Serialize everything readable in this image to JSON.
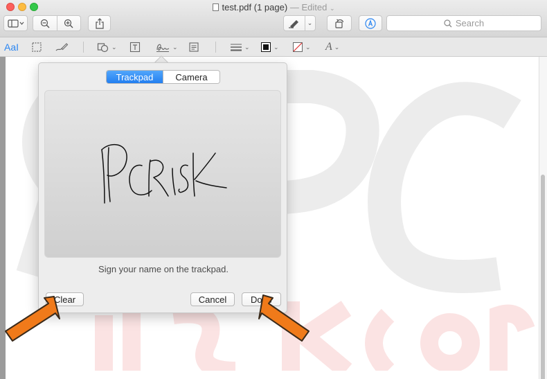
{
  "window": {
    "filename": "test.pdf (1 page)",
    "separator": "—",
    "edited_label": "Edited"
  },
  "toolbar": {
    "search_placeholder": "Search"
  },
  "popover": {
    "tabs": [
      {
        "label": "Trackpad",
        "active": true
      },
      {
        "label": "Camera",
        "active": false
      }
    ],
    "signature_text": "PCRISK",
    "hint": "Sign your name on the trackpad.",
    "clear_label": "Clear",
    "cancel_label": "Cancel",
    "done_label": "Done"
  },
  "colors": {
    "accent": "#2b86f2",
    "arrow": "#f07a1a"
  }
}
